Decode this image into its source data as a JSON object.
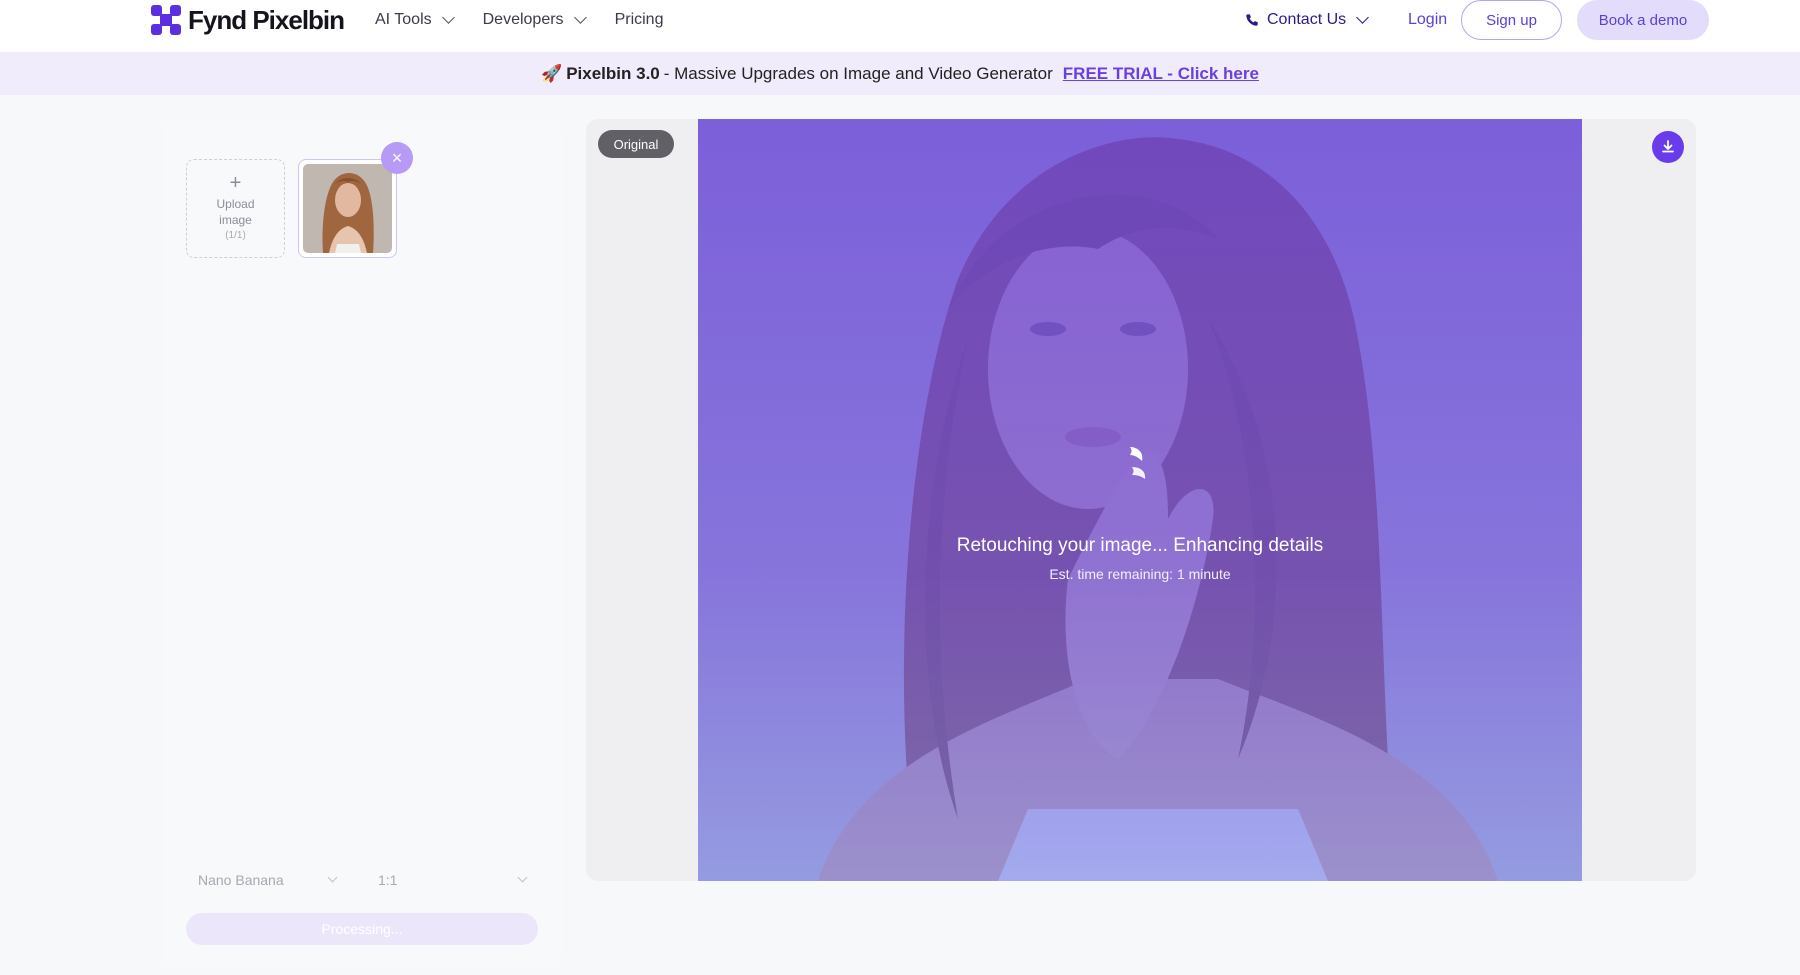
{
  "header": {
    "logo_text": "Fynd Pixelbin",
    "nav": [
      {
        "label": "AI Tools",
        "has_dropdown": true
      },
      {
        "label": "Developers",
        "has_dropdown": true
      },
      {
        "label": "Pricing",
        "has_dropdown": false
      }
    ],
    "contact_label": "Contact Us",
    "login_label": "Login",
    "signup_label": "Sign up",
    "demo_label": "Book a demo"
  },
  "banner": {
    "emoji": "🚀",
    "product": "Pixelbin 3.0",
    "text": " - Massive Upgrades on Image and Video Generator",
    "cta": "FREE TRIAL - Click here"
  },
  "left_panel": {
    "upload": {
      "plus": "+",
      "label_line1": "Upload",
      "label_line2": "image",
      "count": "(1/1)"
    },
    "thumbnail_close": "×",
    "model_select": "Nano Banana",
    "ratio_select": "1:1",
    "process_button": "Processing..."
  },
  "viewer": {
    "badge": "Original",
    "status_title": "Retouching your image... Enhancing details",
    "status_sub": "Est. time remaining: 1 minute"
  },
  "colors": {
    "accent": "#6a3bea",
    "overlay": "#6b48e6",
    "banner_bg": "#f0ecfb"
  },
  "icons": [
    "logo-icon",
    "chevron-down-icon",
    "phone-icon",
    "plus-icon",
    "close-icon",
    "download-icon",
    "spinner-icon"
  ]
}
